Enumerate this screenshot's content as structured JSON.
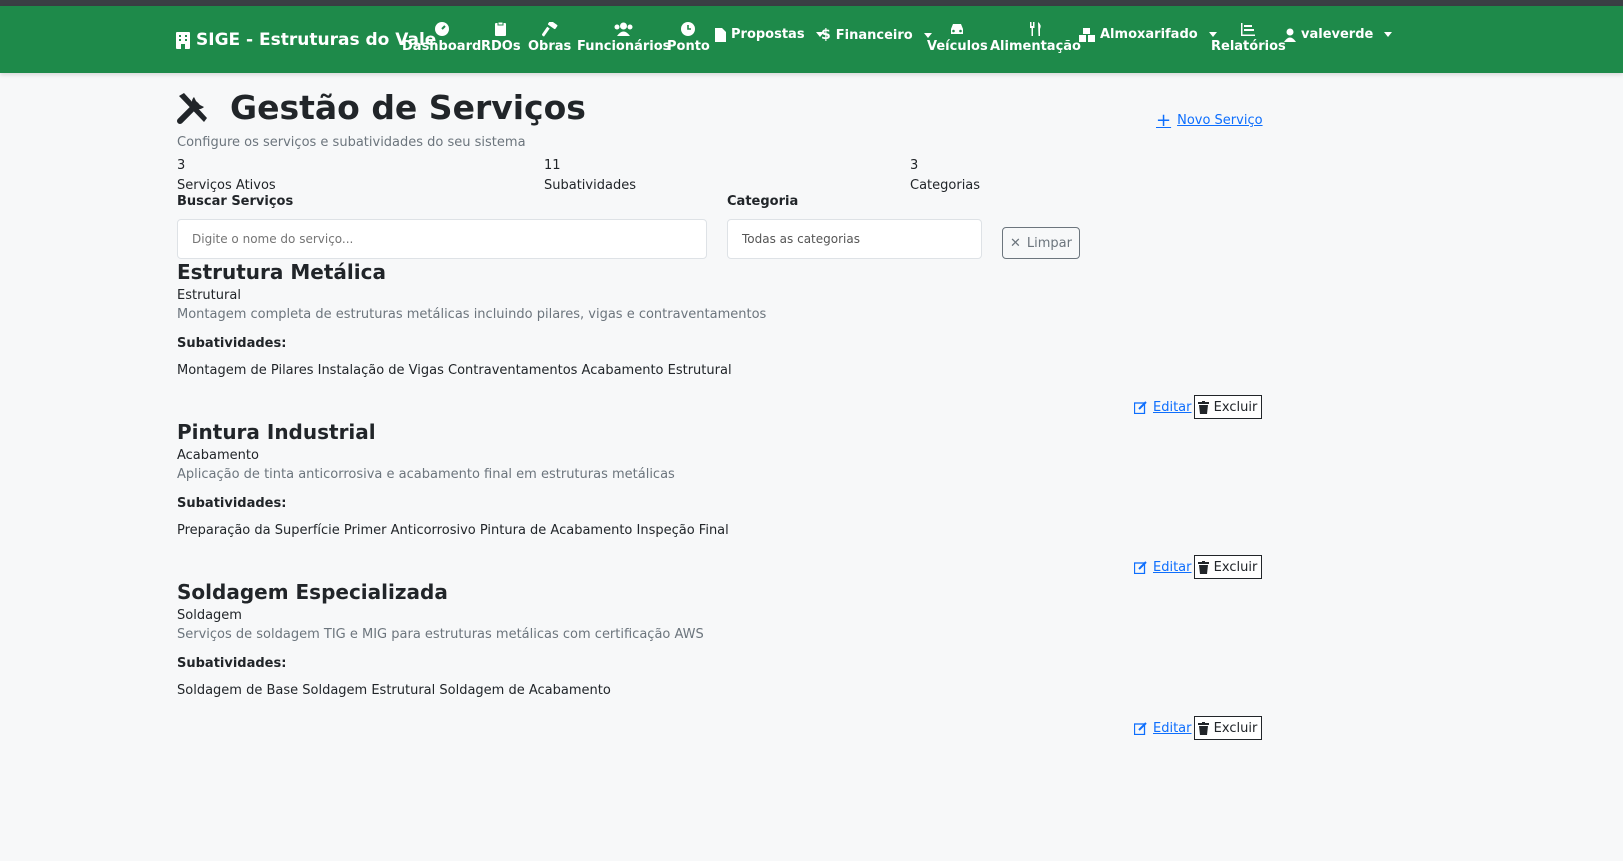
{
  "navbar": {
    "brand": "SIGE - Estruturas do Vale",
    "items": [
      {
        "label": "Dashboard",
        "icon": "gauge-icon"
      },
      {
        "label": "RDOs",
        "icon": "clipboard-icon"
      },
      {
        "label": "Obras",
        "icon": "hammer-icon"
      },
      {
        "label": "Funcionários",
        "icon": "users-icon"
      },
      {
        "label": "Ponto",
        "icon": "clock-icon"
      },
      {
        "label": "Propostas",
        "icon": "file-icon"
      },
      {
        "label": "Financeiro",
        "icon": "dollar-icon"
      },
      {
        "label": "Veículos",
        "icon": "car-icon"
      },
      {
        "label": "Alimentação",
        "icon": "utensils-icon"
      },
      {
        "label": "Almoxarifado",
        "icon": "boxes-icon"
      },
      {
        "label": "Relatórios",
        "icon": "chart-icon"
      }
    ],
    "user": "valeverde"
  },
  "header": {
    "title": "Gestão de Serviços",
    "subtitle": "Configure os serviços e subatividades do seu sistema",
    "new_button": "Novo Serviço"
  },
  "stats": [
    {
      "value": "3",
      "label": "Serviços Ativos"
    },
    {
      "value": "11",
      "label": "Subatividades"
    },
    {
      "value": "3",
      "label": "Categorias"
    }
  ],
  "filters": {
    "search_label": "Buscar Serviços",
    "search_placeholder": "Digite o nome do serviço...",
    "category_label": "Categoria",
    "category_value": "Todas as categorias",
    "clear_label": "Limpar"
  },
  "services": [
    {
      "name": "Estrutura Metálica",
      "category": "Estrutural",
      "description": "Montagem completa de estruturas metálicas incluindo pilares, vigas e contraventamentos",
      "sub_label": "Subatividades:",
      "subactivities": "Montagem de Pilares Instalação de Vigas Contraventamentos Acabamento Estrutural",
      "edit": "Editar",
      "delete": "Excluir"
    },
    {
      "name": "Pintura Industrial",
      "category": "Acabamento",
      "description": "Aplicação de tinta anticorrosiva e acabamento final em estruturas metálicas",
      "sub_label": "Subatividades:",
      "subactivities": "Preparação da Superfície Primer Anticorrosivo Pintura de Acabamento Inspeção Final",
      "edit": "Editar",
      "delete": "Excluir"
    },
    {
      "name": "Soldagem Especializada",
      "category": "Soldagem",
      "description": "Serviços de soldagem TIG e MIG para estruturas metálicas com certificação AWS",
      "sub_label": "Subatividades:",
      "subactivities": "Soldagem de Base Soldagem Estrutural Soldagem de Acabamento",
      "edit": "Editar",
      "delete": "Excluir"
    }
  ],
  "colors": {
    "navbar": "#1e8a4a",
    "link": "#0d6efd",
    "muted": "#6c757d"
  }
}
